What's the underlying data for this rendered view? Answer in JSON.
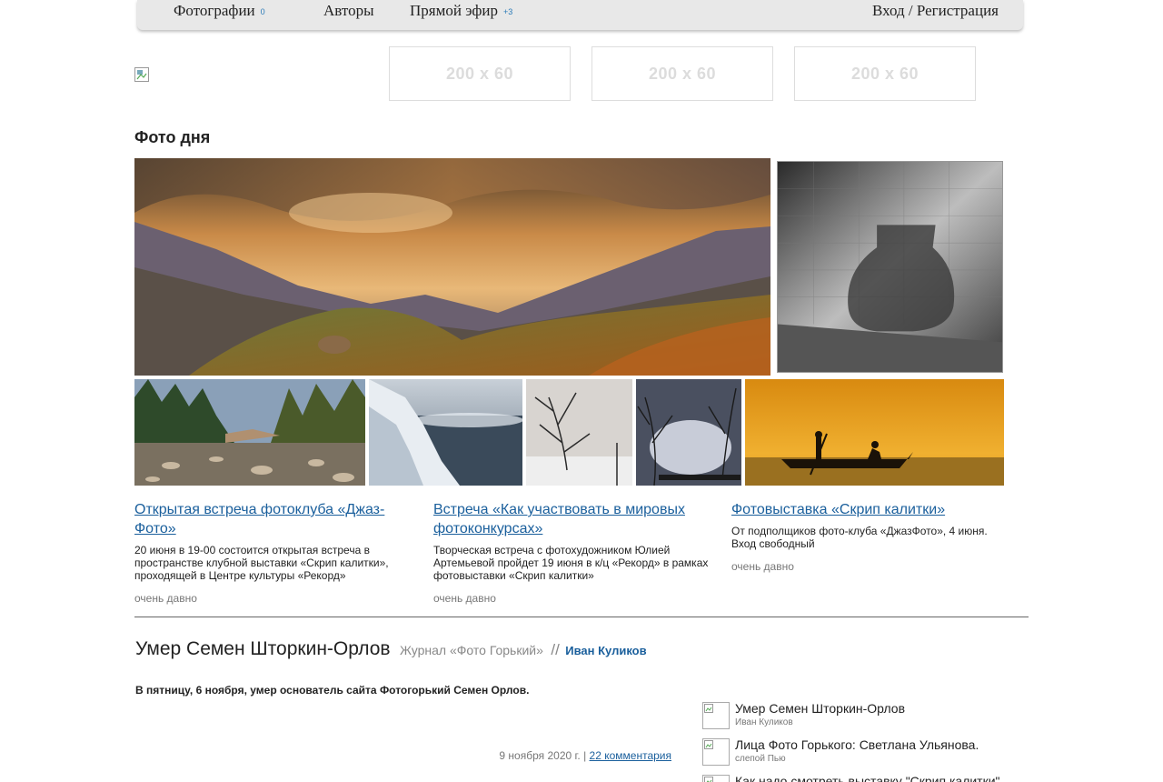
{
  "nav": {
    "photos_label": "Фотографии",
    "photos_count": "0",
    "authors_label": "Авторы",
    "live_label": "Прямой эфир",
    "live_count": "+3",
    "login_label": "Вход / Регистрация"
  },
  "banners": [
    "200 x 60",
    "200 x 60",
    "200 x 60"
  ],
  "photo_of_day": {
    "title": "Фото дня"
  },
  "news": [
    {
      "title": "Открытая встреча фотоклуба «Джаз-Фото»",
      "text": "20 июня в 19-00 состоится открытая встреча в пространстве клубной выставки «Скрип калитки», проходящей в Центре культуры «Рекорд»",
      "time": "очень давно"
    },
    {
      "title": "Встреча «Как участвовать в мировых фотоконкурсах»",
      "text": "Творческая встреча с фотохудожником Юлией Артемьевой пройдет 19 июня в к/ц «Рекорд» в рамках фотовыставки «Скрип калитки»",
      "time": "очень давно"
    },
    {
      "title": "Фотовыставка «Скрип калитки»",
      "text": "От подполщиков фото-клуба «ДжазФото», 4 июня. Вход свободный",
      "time": "очень давно"
    }
  ],
  "article": {
    "title": "Умер Семен Шторкин-Орлов",
    "journal": "Журнал «Фото Горький»",
    "separator": "//",
    "author": "Иван Куликов",
    "lead": "В пятницу, 6 ноября, умер основатель сайта Фотогорький Семен Орлов.",
    "date": "9 ноября 2020 г. |",
    "comments": "22 комментария"
  },
  "related": [
    {
      "title": "Умер Семен Шторкин-Орлов",
      "author": "Иван Куликов"
    },
    {
      "title": "Лица Фото Горького: Светлана Ульянова.",
      "author": "слепой Пью"
    },
    {
      "title": "Как надо смотреть выставку \"Скрип калитки\"",
      "author": ""
    }
  ],
  "colors": {
    "link": "#1a5f9c",
    "count": "#2a7ab8",
    "nav_bg": "#e8e8e8"
  }
}
